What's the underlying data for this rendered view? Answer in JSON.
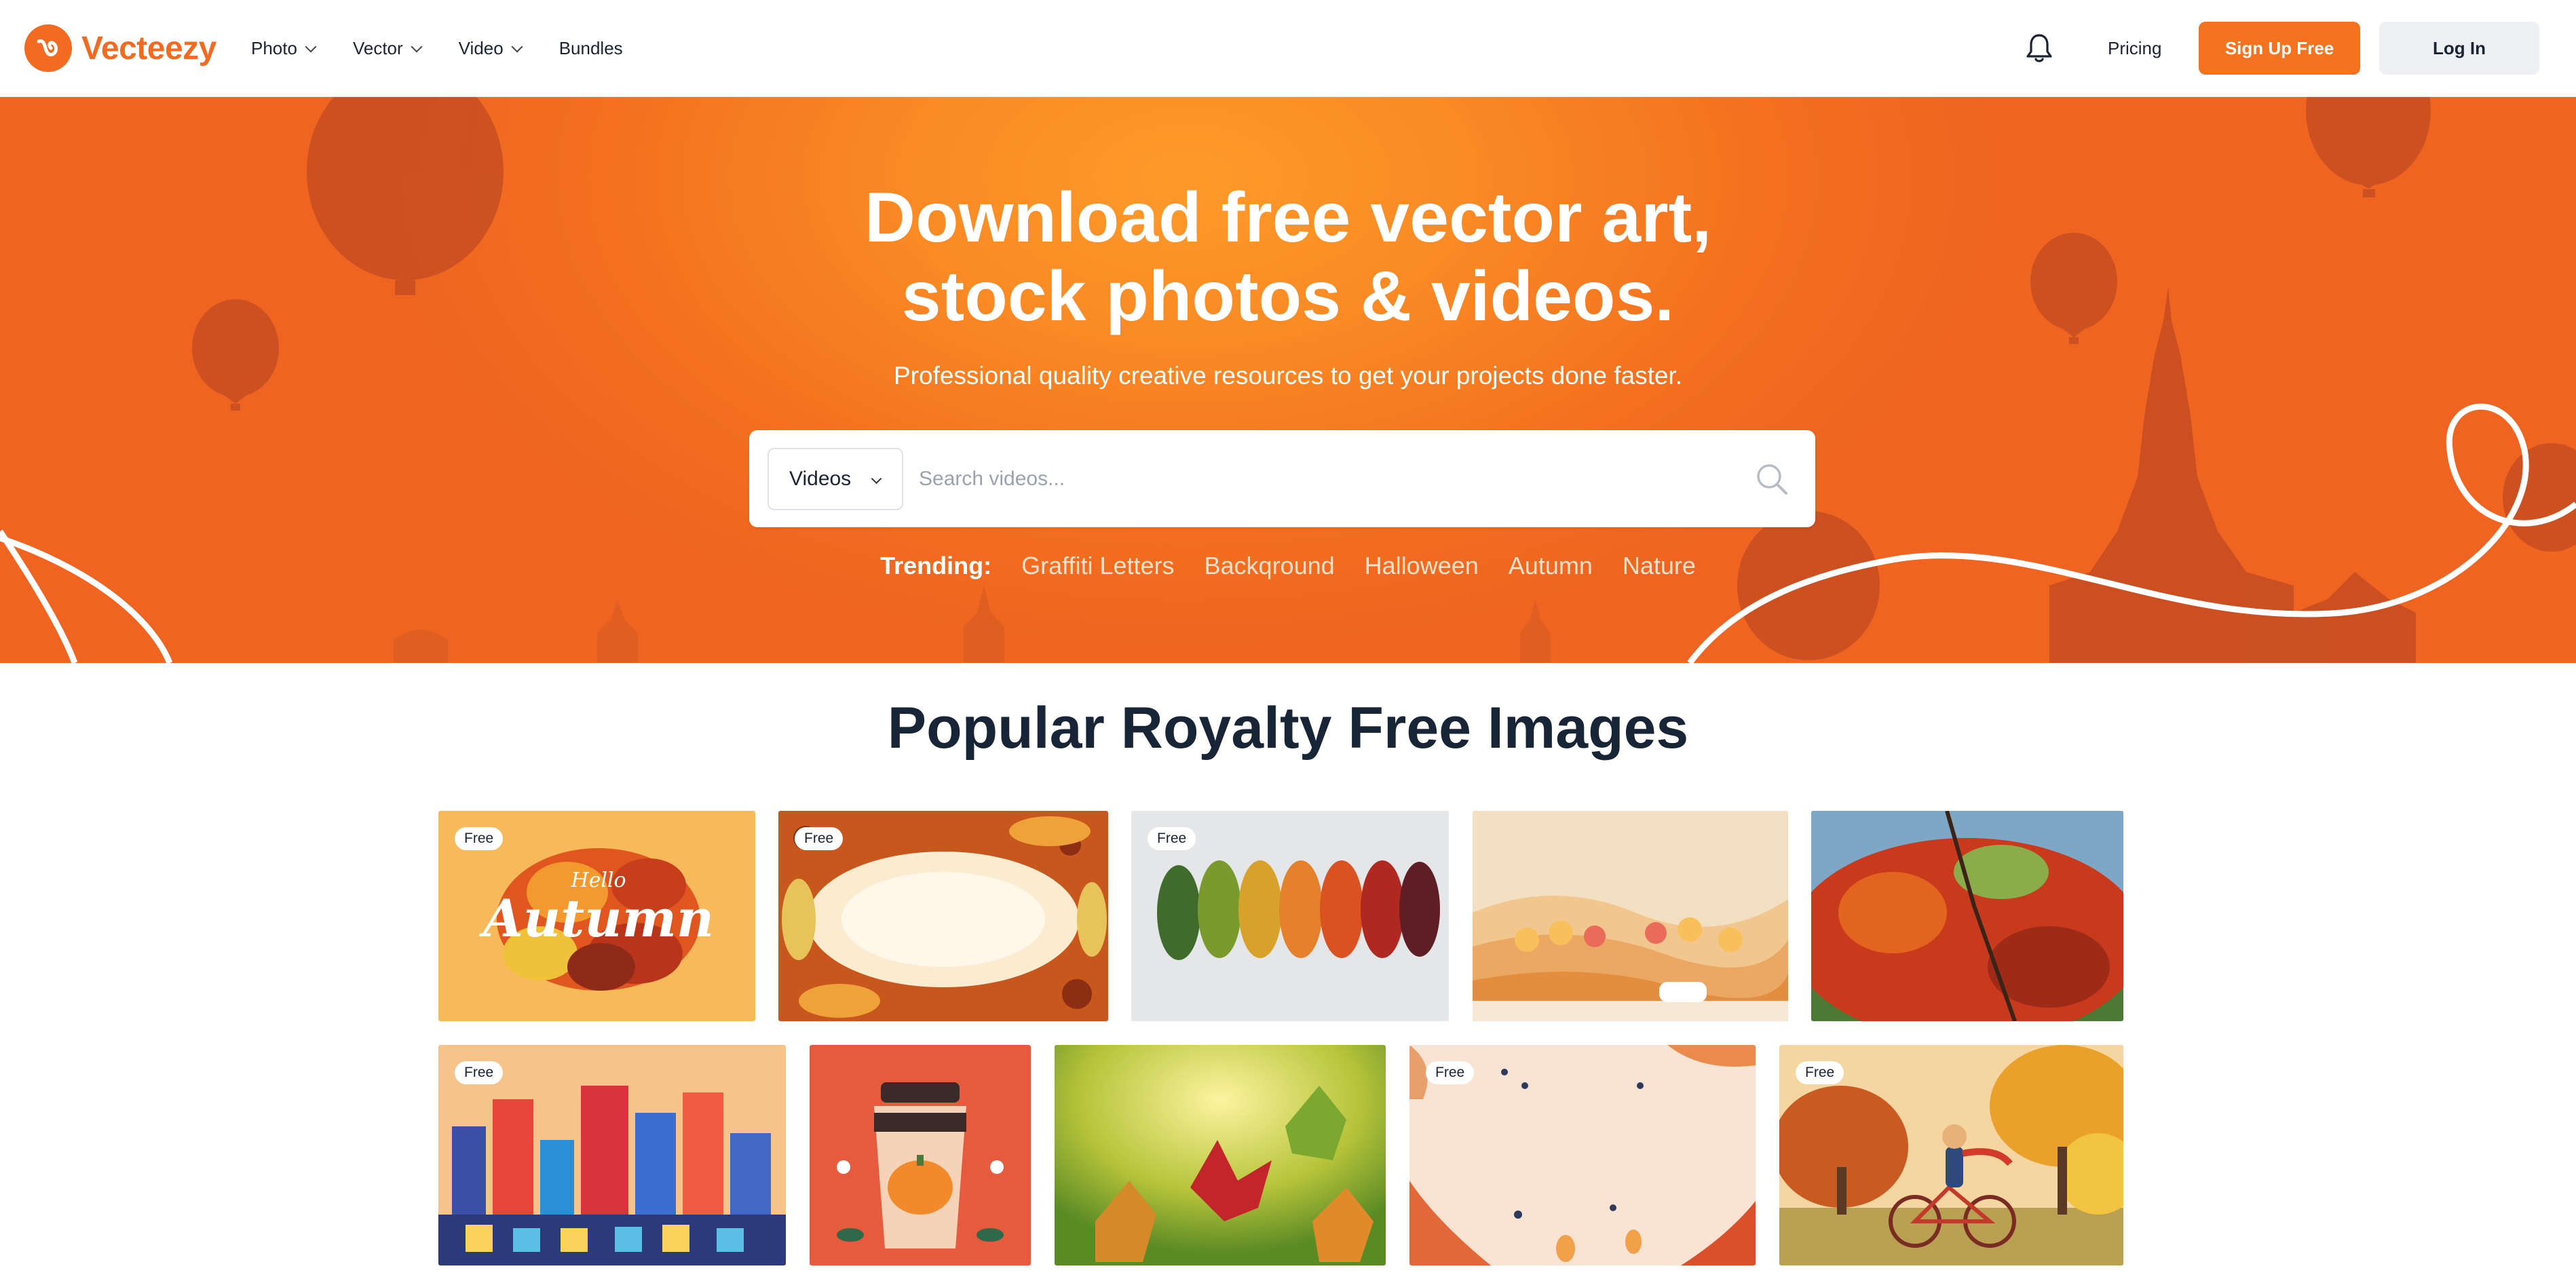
{
  "nav": {
    "logo_text": "Vecteezy",
    "links": [
      {
        "label": "Photo",
        "has_dropdown": true
      },
      {
        "label": "Vector",
        "has_dropdown": true
      },
      {
        "label": "Video",
        "has_dropdown": true
      },
      {
        "label": "Bundles",
        "has_dropdown": false
      }
    ],
    "pricing": "Pricing",
    "signup": "Sign Up Free",
    "login": "Log In",
    "accent": "#f47320"
  },
  "hero": {
    "title_line1": "Download free vector art,",
    "title_line2": "stock photos & videos.",
    "subtitle": "Professional quality creative resources to get your projects done faster.",
    "search": {
      "type_selected": "Videos",
      "placeholder": "Search videos..."
    },
    "trending_label": "Trending:",
    "trending": [
      "Graffiti Letters",
      "Backqround",
      "Halloween",
      "Autumn",
      "Nature"
    ]
  },
  "popular": {
    "title": "Popular Royalty Free Images",
    "badge_text": "Free",
    "tiles": [
      {
        "name": "hello-autumn-lettering",
        "lettering": [
          "Hello",
          "Autumn"
        ],
        "free": true
      },
      {
        "name": "autumn-leaves-frame",
        "free": true
      },
      {
        "name": "colorful-leaves-row",
        "free": true
      },
      {
        "name": "paper-cut-autumn-landscape",
        "free": false
      },
      {
        "name": "red-autumn-tree-branches",
        "free": false
      },
      {
        "name": "flat-city-skyline",
        "free": true
      },
      {
        "name": "pumpkin-coffee-cup",
        "free": false
      },
      {
        "name": "maple-leaves-sunlight",
        "free": false
      },
      {
        "name": "autumn-leaves-background",
        "free": true
      },
      {
        "name": "cyclist-autumn-park",
        "free": true
      }
    ]
  }
}
